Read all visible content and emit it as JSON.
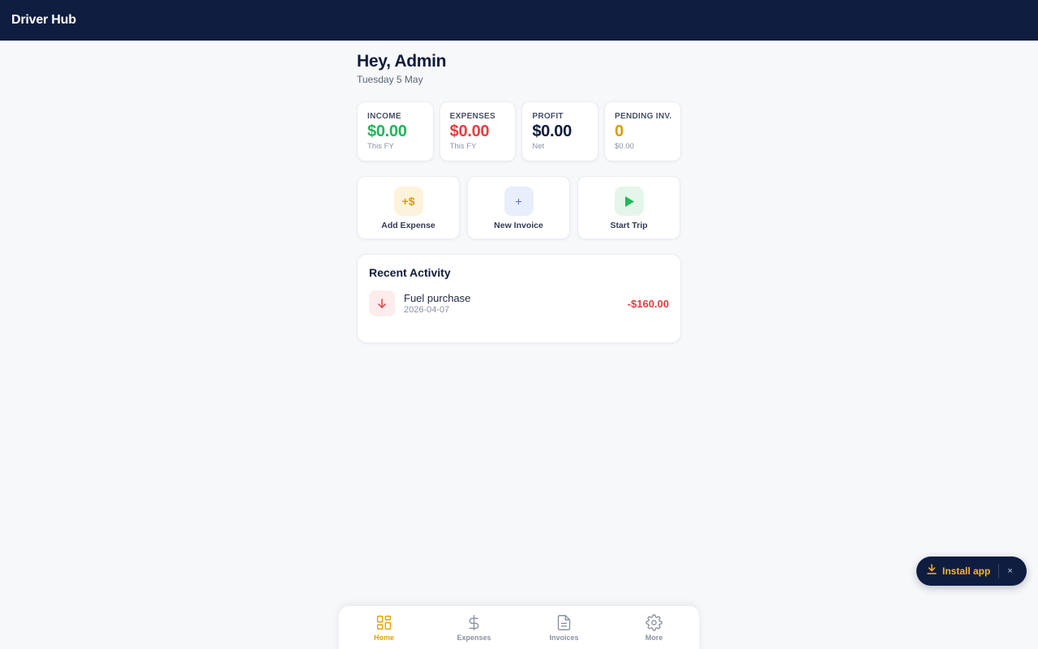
{
  "header": {
    "title": "Driver Hub"
  },
  "greeting": {
    "title": "Hey, Admin",
    "date": "Tuesday 5 May"
  },
  "stats": [
    {
      "label": "INCOME",
      "value": "$0.00",
      "sub": "This FY",
      "color": "#22b55a"
    },
    {
      "label": "EXPENSES",
      "value": "$0.00",
      "sub": "This FY",
      "color": "#e53e3e"
    },
    {
      "label": "PROFIT",
      "value": "$0.00",
      "sub": "Net",
      "color": "#0f1b3d"
    },
    {
      "label": "PENDING INV.",
      "value": "0",
      "sub": "$0.00",
      "color": "#d99a0b"
    }
  ],
  "actions": [
    {
      "label": "Add Expense",
      "icon": "add-money-icon",
      "glyph": "+$",
      "bg": "#fdf3dc",
      "fg": "#d99a0b"
    },
    {
      "label": "New Invoice",
      "icon": "plus-icon",
      "glyph": "+",
      "bg": "#e8eefb",
      "fg": "#4a6fd6"
    },
    {
      "label": "Start Trip",
      "icon": "play-icon",
      "glyph": "",
      "bg": "#e4f6ea",
      "fg": "#22b55a"
    }
  ],
  "activity": {
    "title": "Recent Activity",
    "items": [
      {
        "name": "Fuel purchase",
        "date": "2026-04-07",
        "amount": "-$160.00",
        "icon": "arrow-down-icon"
      }
    ]
  },
  "nav": {
    "items": [
      {
        "label": "Home",
        "icon": "grid-icon",
        "active": true
      },
      {
        "label": "Expenses",
        "icon": "dollar-icon",
        "active": false
      },
      {
        "label": "Invoices",
        "icon": "document-icon",
        "active": false
      },
      {
        "label": "More",
        "icon": "gear-icon",
        "active": false
      }
    ]
  },
  "install": {
    "label": "Install app",
    "close": "×"
  },
  "colors": {
    "navy": "#0f1d40",
    "accent": "#e3a008",
    "danger": "#e53e3e",
    "success": "#22b55a"
  }
}
